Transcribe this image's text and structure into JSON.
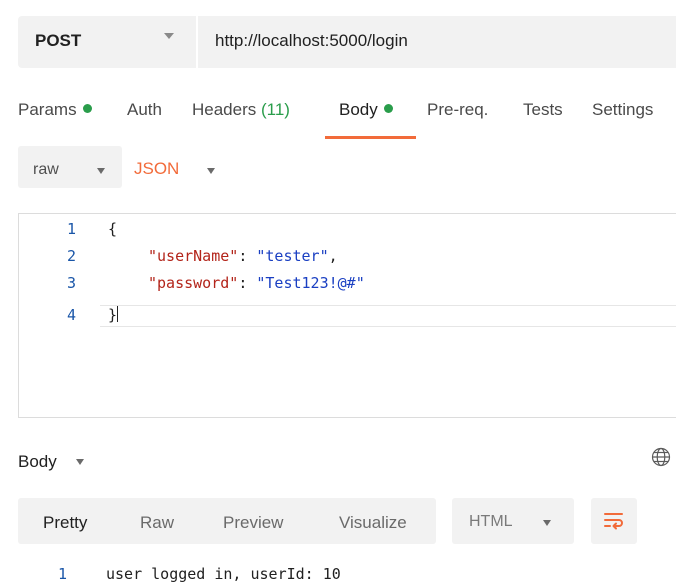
{
  "request": {
    "method": "POST",
    "url": "http://localhost:5000/login"
  },
  "tabs": [
    {
      "label": "Params",
      "dot": true
    },
    {
      "label": "Auth"
    },
    {
      "label": "Headers",
      "count": "(11)"
    },
    {
      "label": "Body",
      "dot": true,
      "active": true
    },
    {
      "label": "Pre-req."
    },
    {
      "label": "Tests"
    },
    {
      "label": "Settings"
    }
  ],
  "body_type": {
    "mode": "raw",
    "language": "JSON"
  },
  "editor": {
    "line_numbers": [
      "1",
      "2",
      "3",
      "4"
    ],
    "open_brace": "{",
    "close_brace": "}",
    "key1": "\"userName\"",
    "val1": "\"tester\"",
    "key2": "\"password\"",
    "val2": "\"Test123!@#\"",
    "colon": ": ",
    "comma": ","
  },
  "response": {
    "section_label": "Body",
    "view_tabs": [
      "Pretty",
      "Raw",
      "Preview",
      "Visualize"
    ],
    "active_view": "Pretty",
    "format": "HTML",
    "line_number": "1",
    "text": "user logged in, userId: 10"
  },
  "colors": {
    "accent": "#f26b3a",
    "dot_green": "#2a9d4b",
    "json_key": "#b3241a",
    "json_string": "#1a3fc2",
    "line_number": "#1a56a8"
  },
  "icons": {
    "method_dropdown": "chevron-down-icon",
    "globe": "globe-icon",
    "wrap": "wrap-lines-icon"
  }
}
